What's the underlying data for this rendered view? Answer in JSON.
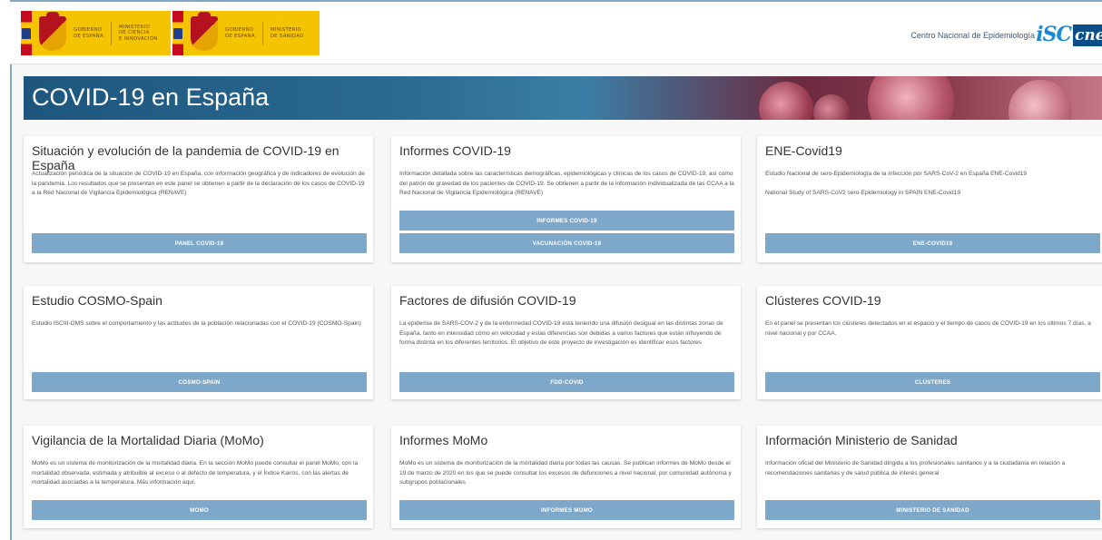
{
  "header": {
    "gov1": {
      "label_a": "GOBIERNO\nDE ESPAÑA",
      "label_b": "MINISTERIO\nDE CIENCIA\nE INNOVACIÓN"
    },
    "gov2": {
      "label_a": "GOBIERNO\nDE ESPAÑA",
      "label_b": "MINISTERIO\nDE SANIDAD"
    },
    "centro": "Centro Nacional de Epidemiología",
    "isciii": "iSC",
    "cne": "cne"
  },
  "banner": {
    "title": "COVID-19 en España"
  },
  "cards": [
    {
      "title": "Situación y evolución de la pandemia de COVID-19 en España",
      "text": "Actualización periódica de la situación de COVID-19 en España, con información geográfica y de indicadores de evolución de la pandemia. Los resultados que se presentan en este panel se obtienen a partir de la declaración de los casos de COVID-19 a la Red Nacional de Vigilancia Epidemiológica (RENAVE)",
      "buttons": [
        "PANEL COVID-19"
      ]
    },
    {
      "title": "Informes COVID-19",
      "text": "Información detallada sobre las características demográficas, epidemiológicas y clínicas de los casos de COVID-19, así como del patrón de gravedad de los pacientes de COVID-19. Se obtienen a partir de la información individualizada de las CCAA a la Red Nacional de Vigilancia Epidemiológica (RENAVE)",
      "buttons": [
        "INFORMES COVID-19",
        "VACUNACIÓN COVID-19"
      ]
    },
    {
      "title": "ENE-Covid19",
      "text": "Estudio Nacional de sero-Epidemiología de la infección por SARS-CoV-2 en España ENE-Covid19",
      "text2": "National Study of SARS-CoV2 sero-Epidemiology in SPAIN ENE-Covid19",
      "buttons": [
        "ENE-COVID19"
      ]
    },
    {
      "title": "Estudio COSMO-Spain",
      "text": "Estudio ISCIII-OMS sobre el comportamiento y las actitudes de la población relacionadas con el COVID-19 (COSMO-Spain)",
      "buttons": [
        "COSMO-SPAIN"
      ]
    },
    {
      "title": "Factores de difusión COVID-19",
      "text": "La epidemia de SARS-COV-2 y de la enfermedad COVID-19 está teniendo una difusión desigual en las distintas zonas de España, tanto en intensidad cómo en velocidad y estas diferencias son debidas a varios factores que están influyendo de forma distinta en los diferentes territorios. El objetivo de este proyecto de investigación es identificar esos factores",
      "buttons": [
        "FDD-COVID"
      ]
    },
    {
      "title": "Clústeres COVID-19",
      "text": "En el panel se presentan los clústeres detectados en el espacio y el tiempo de casos de COVID-19 en los últimos 7 días, a nivel nacional y por CCAA.",
      "buttons": [
        "CLÚSTERES"
      ]
    },
    {
      "title": "Vigilancia de la Mortalidad Diaria (MoMo)",
      "text": "MoMo es un sistema de monitorización de la mortalidad diaria. En la sección MoMo puede consultar el panel MoMo, con la mortalidad observada, estimada y atribuible al exceso o al defecto de temperatura, y el Índice Kairós, con las alertas de mortalidad asociadas a la temperatura. Más información aquí.",
      "buttons": [
        "MOMO"
      ]
    },
    {
      "title": "Informes MoMo",
      "text": "MoMo es un sistema de monitorización de la mortalidad diaria por todas las causas. Se publican informes de MoMo desde el 19 de marzo de 2020 en los que se puede consultar los excesos de defunciones a nivel nacional, por comunidad autónoma y subgrupos poblacionales",
      "buttons": [
        "INFORMES MOMO"
      ]
    },
    {
      "title": "Información Ministerio de Sanidad",
      "text": "Información oficial del Ministerio de Sanidad dirigida a los profesionales sanitarios y a la ciudadanía en relación a recomendaciones sanitarias y de salud pública de interés general",
      "buttons": [
        "MINISTERIO DE SANIDAD"
      ]
    }
  ]
}
